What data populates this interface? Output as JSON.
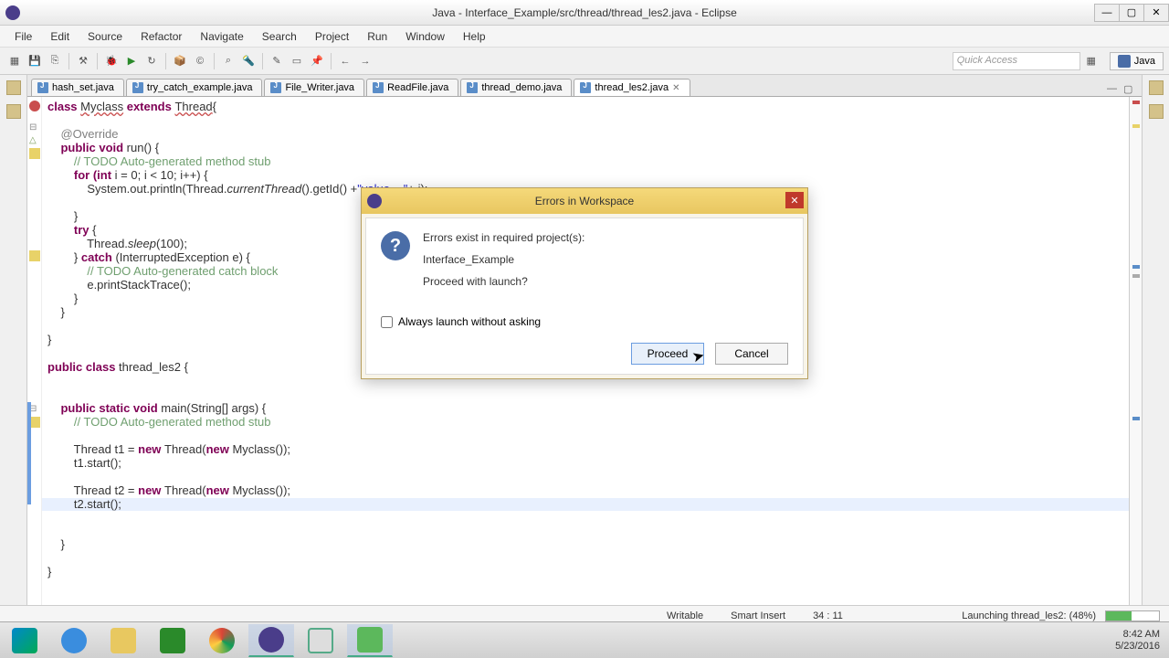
{
  "window": {
    "title": "Java - Interface_Example/src/thread/thread_les2.java - Eclipse"
  },
  "menu": {
    "items": [
      "File",
      "Edit",
      "Source",
      "Refactor",
      "Navigate",
      "Search",
      "Project",
      "Run",
      "Window",
      "Help"
    ]
  },
  "toolbar": {
    "quick_access_placeholder": "Quick Access",
    "perspective_label": "Java"
  },
  "tabs": [
    {
      "label": "hash_set.java",
      "active": false
    },
    {
      "label": "try_catch_example.java",
      "active": false
    },
    {
      "label": "File_Writer.java",
      "active": false
    },
    {
      "label": "ReadFile.java",
      "active": false
    },
    {
      "label": "thread_demo.java",
      "active": false
    },
    {
      "label": "thread_les2.java",
      "active": true
    }
  ],
  "code": {
    "l1_a": "class ",
    "l1_b": "Myclass",
    "l1_c": " extends ",
    "l1_d": "Thread",
    "l1_e": "{",
    "l2": "",
    "l3_a": "    ",
    "l3_b": "@Override",
    "l4_a": "    public void ",
    "l4_b": "run() {",
    "l5_a": "        ",
    "l5_b": "// TODO Auto-generated method stub",
    "l6_a": "        for ",
    "l6_b": "(int ",
    "l6_c": "i = 0; i < 10; i++) {",
    "l7_a": "            System.out.println(Thread.",
    "l7_b": "currentThread",
    "l7_c": "().getId() +",
    "l7_d": "\"value = \"",
    "l7_e": "+ i);",
    "l8": "",
    "l9": "        }",
    "l10_a": "        try ",
    "l10_b": "{",
    "l11_a": "            Thread.",
    "l11_b": "sleep",
    "l11_c": "(100);",
    "l12_a": "        } ",
    "l12_b": "catch ",
    "l12_c": "(InterruptedException e) {",
    "l13_a": "            ",
    "l13_b": "// TODO Auto-generated catch block",
    "l14": "            e.printStackTrace();",
    "l15": "        }",
    "l16": "    }",
    "l17": "",
    "l18": "}",
    "l19": "",
    "l20_a": "public class ",
    "l20_b": "thread_les2 {",
    "l21": "",
    "l22": "",
    "l23_a": "    public static void ",
    "l23_b": "main(String[] args) {",
    "l24_a": "        ",
    "l24_b": "// TODO Auto-generated method stub",
    "l25": "",
    "l26_a": "        Thread t1 = ",
    "l26_b": "new ",
    "l26_c": "Thread(",
    "l26_d": "new ",
    "l26_e": "Myclass());",
    "l27": "        t1.start();",
    "l28": "",
    "l29_a": "        Thread t2 = ",
    "l29_b": "new ",
    "l29_c": "Thread(",
    "l29_d": "new ",
    "l29_e": "Myclass());",
    "l30": "        t2.start();",
    "l31": "",
    "l32": "",
    "l33": "    }",
    "l34": "",
    "l35": "}"
  },
  "dialog": {
    "title": "Errors in Workspace",
    "line1": "Errors exist in required project(s):",
    "line2": "Interface_Example",
    "line3": "Proceed with launch?",
    "checkbox_label": "Always launch without asking",
    "proceed": "Proceed",
    "cancel": "Cancel"
  },
  "status": {
    "writable": "Writable",
    "insert": "Smart Insert",
    "position": "34 : 11",
    "launching": "Launching thread_les2: (48%)"
  },
  "clock": {
    "time": "8:42 AM",
    "date": "5/23/2016"
  }
}
